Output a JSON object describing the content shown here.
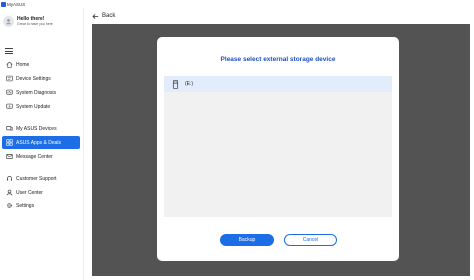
{
  "app": {
    "name": "MyASUS",
    "brand_color": "#1d6de6"
  },
  "user": {
    "greeting": "Hello there!",
    "subtitle": "Great to have you here"
  },
  "sidebar": {
    "items": [
      {
        "label": "Home",
        "icon": "home-icon"
      },
      {
        "label": "Device Settings",
        "icon": "settings-sliders-icon"
      },
      {
        "label": "System Diagnosis",
        "icon": "diagnosis-icon"
      },
      {
        "label": "System Update",
        "icon": "update-icon"
      },
      {
        "label": "My ASUS Devices",
        "icon": "devices-icon"
      },
      {
        "label": "ASUS Apps & Deals",
        "icon": "apps-icon",
        "active": true
      },
      {
        "label": "Message Center",
        "icon": "message-icon"
      },
      {
        "label": "Customer Support",
        "icon": "support-icon"
      },
      {
        "label": "User Center",
        "icon": "user-icon"
      },
      {
        "label": "Settings",
        "icon": "gear-icon"
      }
    ]
  },
  "header": {
    "back_label": "Back"
  },
  "dialog": {
    "title": "Please select external storage device",
    "devices": [
      {
        "label": "(E:)",
        "icon": "usb-drive-icon",
        "selected": true
      }
    ],
    "backup_label": "Backup",
    "cancel_label": "Cancel",
    "overlay_color": "#535353"
  }
}
